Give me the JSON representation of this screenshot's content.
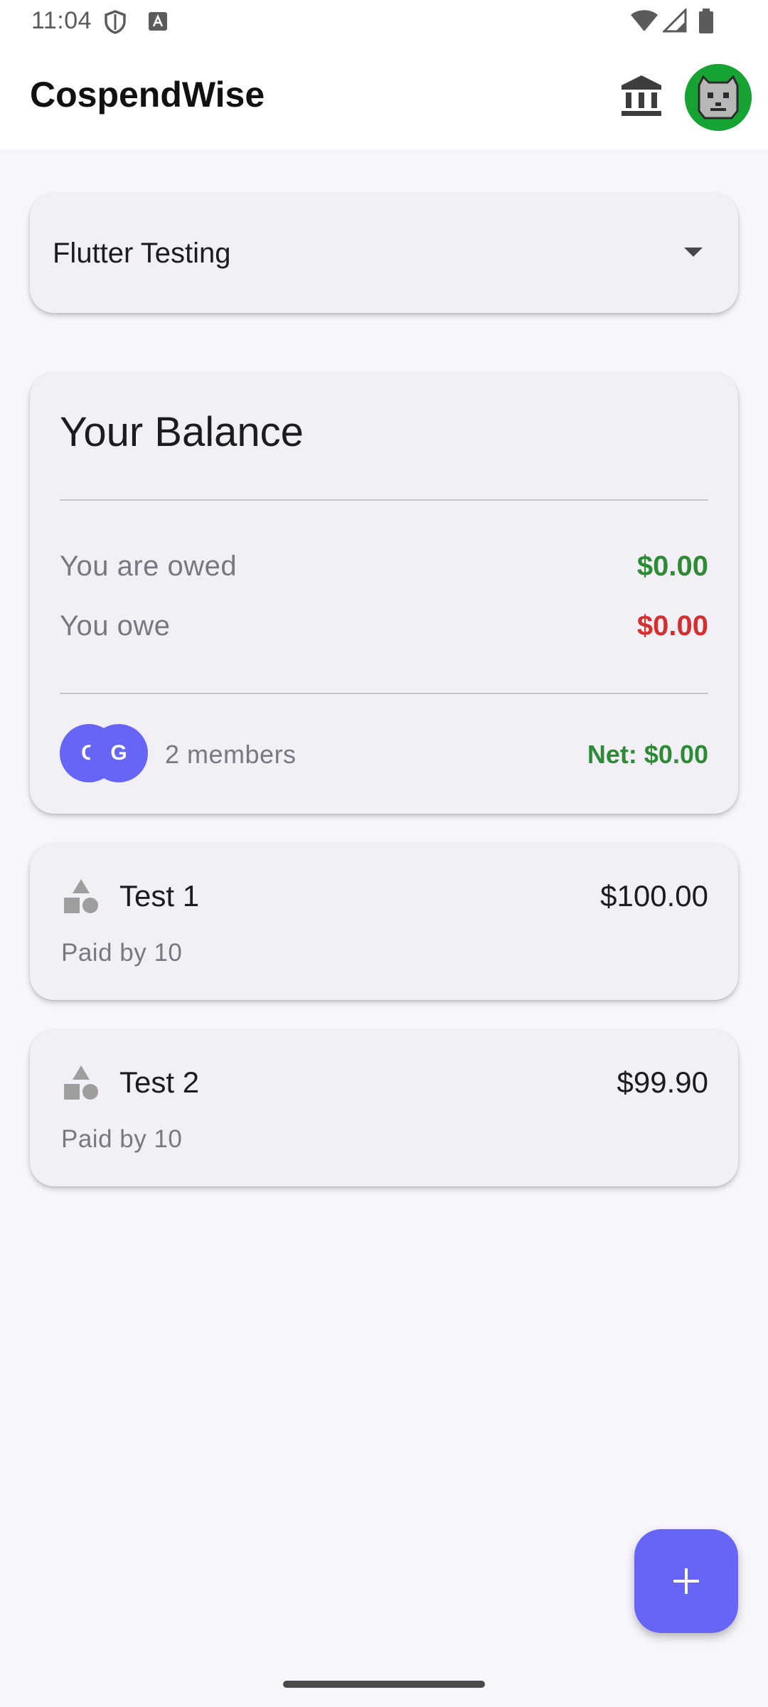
{
  "status_bar": {
    "time": "11:04",
    "icons": [
      "shield-icon",
      "keyboard-a-icon",
      "wifi-icon",
      "signal-icon",
      "battery-icon"
    ]
  },
  "app_bar": {
    "title": "CospendWise",
    "actions": [
      "bank-icon",
      "profile-avatar"
    ]
  },
  "group_selector": {
    "selected": "Flutter Testing"
  },
  "balance": {
    "title": "Your Balance",
    "owed_label": "You are owed",
    "owed_value": "$0.00",
    "owe_label": "You owe",
    "owe_value": "$0.00",
    "members": [
      {
        "initial": "C"
      },
      {
        "initial": "G"
      }
    ],
    "members_text": "2 members",
    "net_text": "Net: $0.00"
  },
  "expenses": [
    {
      "title": "Test 1",
      "amount": "$100.00",
      "subtitle": "Paid by 10",
      "icon": "category-icon"
    },
    {
      "title": "Test 2",
      "amount": "$99.90",
      "subtitle": "Paid by 10",
      "icon": "category-icon"
    }
  ],
  "fab": {
    "icon": "add-icon"
  },
  "colors": {
    "accent": "#6765f6",
    "positive": "#2e8b35",
    "negative": "#d32f2f",
    "card": "#f2eff7",
    "background": "#f8f5fc"
  }
}
